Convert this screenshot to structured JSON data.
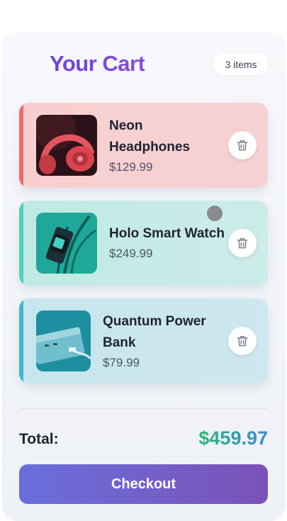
{
  "header": {
    "title": "Your Cart",
    "item_count": "3 items"
  },
  "items": [
    {
      "name_line1": "Neon",
      "name_line2": "Headphones",
      "price": "$129.99"
    },
    {
      "name_line1": "Holo Smart Watch",
      "name_line2": "",
      "price": "$249.99"
    },
    {
      "name_line1": "Quantum Power",
      "name_line2": "Bank",
      "price": "$79.99"
    }
  ],
  "summary": {
    "total_label": "Total:",
    "total_value": "$459.97",
    "checkout_label": "Checkout"
  },
  "colors": {
    "title_gradient": [
      "#6d3fe0",
      "#8a4fd6"
    ],
    "total_gradient": [
      "#2bb673",
      "#3a8bd8"
    ],
    "checkout_gradient": [
      "#6a6fdc",
      "#7b52b8"
    ],
    "card_accents": [
      "#ee6a6a",
      "#4fd0bc",
      "#43b7cc"
    ]
  },
  "icons": [
    "delete-icon"
  ]
}
